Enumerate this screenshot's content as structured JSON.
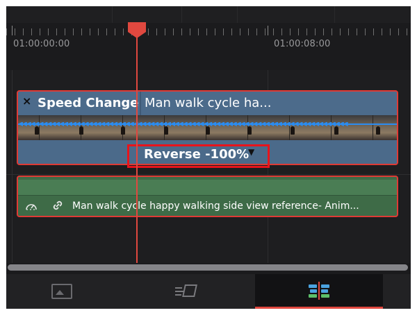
{
  "ruler": {
    "timecodes": [
      "01:00:00:00",
      "01:00:08:00"
    ]
  },
  "video_clip": {
    "close_glyph": "×",
    "speed_label": "Speed Change",
    "clip_name": "Man walk cycle ha...",
    "speed_value": "Reverse -100%",
    "dropdown_glyph": "▼",
    "arrow_glyphs": "◀◀◀◀◀◀◀◀◀◀◀◀◀◀◀◀◀◀◀◀◀◀◀◀◀◀◀◀◀◀◀◀◀◀◀◀◀◀◀◀◀◀◀◀◀◀◀◀◀◀◀◀◀◀◀◀◀◀◀◀◀◀◀◀◀◀◀◀◀◀◀◀◀◀◀◀◀◀◀◀"
  },
  "audio_clip": {
    "gauge_icon": "speedometer-icon",
    "link_icon": "link-icon",
    "clip_name": "Man walk cycle happy walking side view reference- Anim..."
  },
  "bottom_tabs": [
    {
      "icon": "media-pool-icon",
      "active": false
    },
    {
      "icon": "cut-page-icon",
      "active": false
    },
    {
      "icon": "edit-page-icon",
      "active": true
    }
  ],
  "colors": {
    "playhead": "#e0483f",
    "highlight_box": "#e8141b",
    "video_clip": "#4b6a8a",
    "audio_clip": "#3e6b47",
    "retime_arrows": "#2b8cf0"
  }
}
